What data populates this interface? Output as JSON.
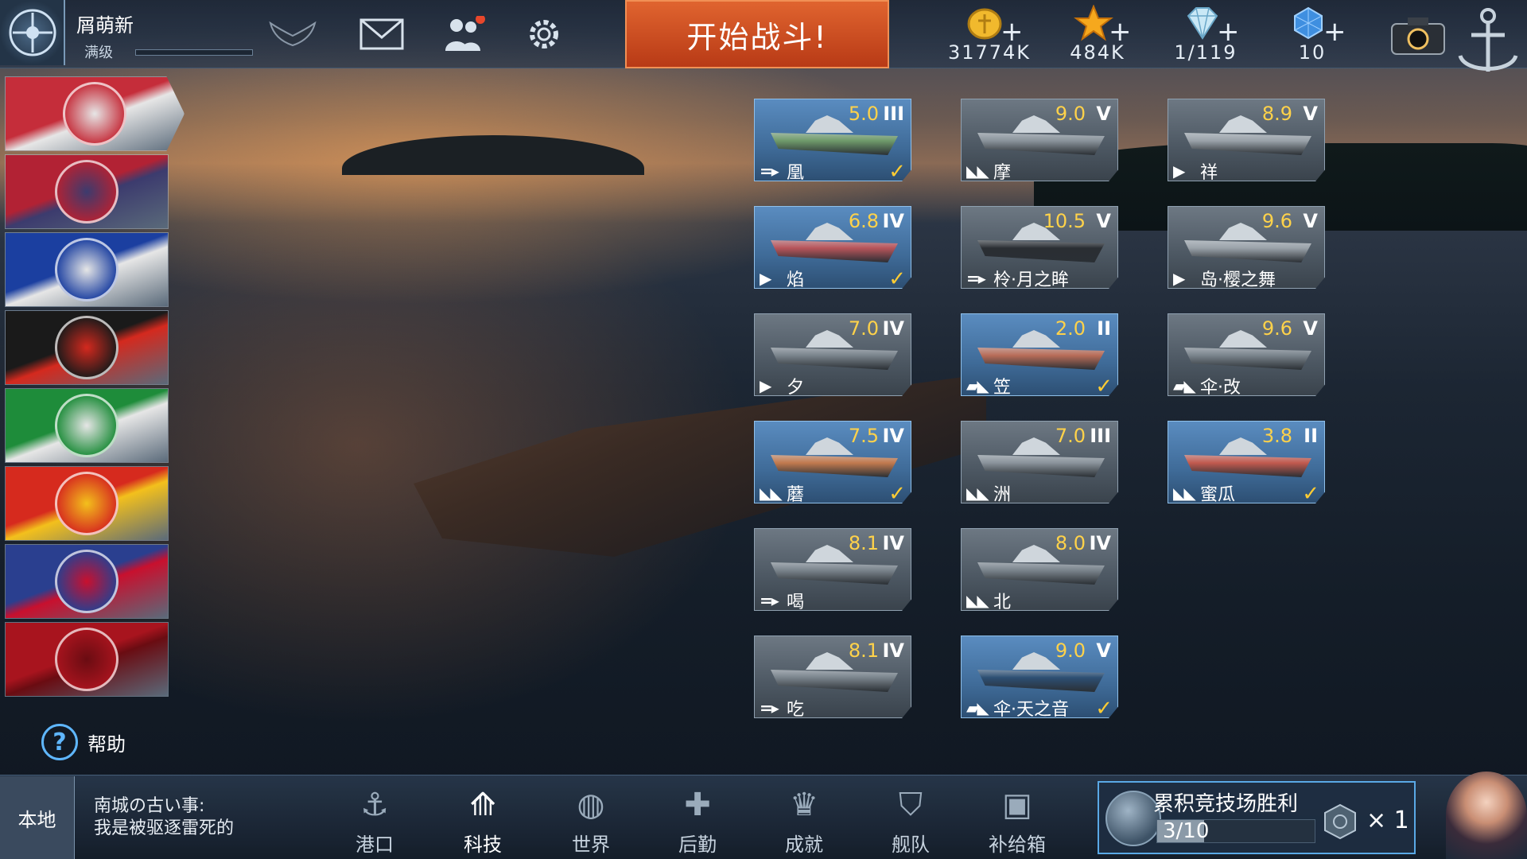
{
  "player": {
    "name": "屑萌新",
    "level": "满级"
  },
  "header": {
    "start_battle": "开始战斗!"
  },
  "currencies": [
    {
      "icon": "gold-coin-icon",
      "value": "31774K"
    },
    {
      "icon": "star-icon",
      "value": "484K"
    },
    {
      "icon": "diamond-icon",
      "value": "1/119"
    },
    {
      "icon": "blue-gem-icon",
      "value": "10"
    }
  ],
  "nations": [
    {
      "name": "japan",
      "colors": [
        "#c52d3a",
        "#e6e6e6"
      ],
      "icon": "japan-emblem-icon"
    },
    {
      "name": "usa",
      "colors": [
        "#b22234",
        "#3c3b6e"
      ],
      "icon": "eagle-emblem-icon"
    },
    {
      "name": "france",
      "colors": [
        "#1b3fa0",
        "#e6e6e6"
      ],
      "icon": "fleur-de-lis-icon"
    },
    {
      "name": "germany",
      "colors": [
        "#1a1a1a",
        "#d4291e"
      ],
      "icon": "iron-cross-icon"
    },
    {
      "name": "italy",
      "colors": [
        "#1e8c3a",
        "#e6e6e6"
      ],
      "icon": "italy-star-icon"
    },
    {
      "name": "china",
      "colors": [
        "#d62a1e",
        "#f3c01c"
      ],
      "icon": "china-emblem-icon"
    },
    {
      "name": "uk",
      "colors": [
        "#2a3f8f",
        "#c8102e"
      ],
      "icon": "crown-icon"
    },
    {
      "name": "soviet",
      "colors": [
        "#a8141e",
        "#6a0c12"
      ],
      "icon": "hammer-sickle-icon"
    }
  ],
  "help": {
    "label": "帮助"
  },
  "ships": [
    {
      "name": "凰",
      "rating": "5.0",
      "tier": "III",
      "type": "=▸",
      "owned": true
    },
    {
      "name": "摩",
      "rating": "9.0",
      "tier": "V",
      "type": "◣◣",
      "owned": false
    },
    {
      "name": "祥",
      "rating": "8.9",
      "tier": "V",
      "type": "▶",
      "owned": false
    },
    {
      "name": "焰",
      "rating": "6.8",
      "tier": "IV",
      "type": "▶",
      "owned": true
    },
    {
      "name": "柃·月之眸",
      "rating": "10.5",
      "tier": "V",
      "type": "=▸",
      "owned": false
    },
    {
      "name": "岛·樱之舞",
      "rating": "9.6",
      "tier": "V",
      "type": "▶",
      "owned": false
    },
    {
      "name": "夕",
      "rating": "7.0",
      "tier": "IV",
      "type": "▶",
      "owned": false
    },
    {
      "name": "笠",
      "rating": "2.0",
      "tier": "II",
      "type": "▰◣",
      "owned": true
    },
    {
      "name": "伞·改",
      "rating": "9.6",
      "tier": "V",
      "type": "▰◣",
      "owned": false
    },
    {
      "name": "蘑",
      "rating": "7.5",
      "tier": "IV",
      "type": "◣◣",
      "owned": true
    },
    {
      "name": "洲",
      "rating": "7.0",
      "tier": "III",
      "type": "◣◣",
      "owned": false
    },
    {
      "name": "蜜瓜",
      "rating": "3.8",
      "tier": "II",
      "type": "◣◣",
      "owned": true
    },
    {
      "name": "喝",
      "rating": "8.1",
      "tier": "IV",
      "type": "=▸",
      "owned": false
    },
    {
      "name": "北",
      "rating": "8.0",
      "tier": "IV",
      "type": "◣◣",
      "owned": false
    },
    {
      "name": "吃",
      "rating": "8.1",
      "tier": "IV",
      "type": "=▸",
      "owned": false
    },
    {
      "name": "伞·天之音",
      "rating": "9.0",
      "tier": "V",
      "type": "▰◣",
      "owned": true
    }
  ],
  "chat": {
    "tab": "本地",
    "line1": "南城の古い事:",
    "line2": "我是被驱逐雷死的"
  },
  "nav": [
    {
      "label": "港口",
      "icon": "harbor-icon"
    },
    {
      "label": "科技",
      "icon": "tech-icon",
      "active": true
    },
    {
      "label": "世界",
      "icon": "globe-icon"
    },
    {
      "label": "后勤",
      "icon": "logistics-icon"
    },
    {
      "label": "成就",
      "icon": "achievement-icon"
    },
    {
      "label": "舰队",
      "icon": "fleet-icon"
    },
    {
      "label": "补给箱",
      "icon": "supply-box-icon"
    }
  ],
  "arena": {
    "title": "累积竞技场胜利",
    "progress": "3/10",
    "progress_fraction": 0.3,
    "reward_multiplier": "× 1"
  }
}
